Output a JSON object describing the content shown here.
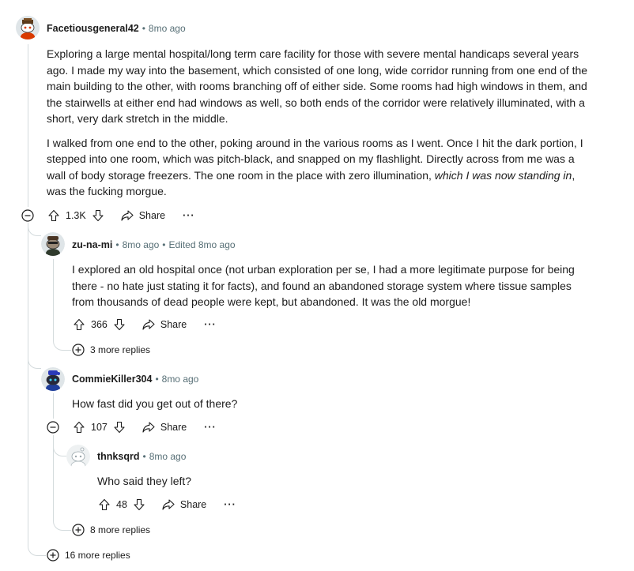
{
  "comments": {
    "c1": {
      "author": "Facetiousgeneral42",
      "time": "8mo ago",
      "para1": "Exploring a large mental hospital/long term care facility for those with severe mental handicaps several years ago. I made my way into the basement, which consisted of one long, wide corridor running from one end of the main building to the other, with rooms branching off of either side. Some rooms had high windows in them, and the stairwells at either end had windows as well, so both ends of the corridor were relatively illuminated, with a short, very dark stretch in the middle.",
      "para2_a": "I walked from one end to the other, poking around in the various rooms as I went. Once I hit the dark portion, I stepped into one room, which was pitch-black, and snapped on my flashlight. Directly across from me was a wall of body storage freezers. The one room in the place with zero illumination, ",
      "para2_em": "which I was now standing in",
      "para2_b": ", was the fucking morgue.",
      "votes": "1.3K",
      "share": "Share",
      "more_replies": "16 more replies"
    },
    "c2": {
      "author": "zu-na-mi",
      "time": "8mo ago",
      "edited": "Edited 8mo ago",
      "text": "I explored an old hospital once (not urban exploration per se, I had a more legitimate purpose for being there - no hate just stating it for facts), and found an abandoned storage system where tissue samples from thousands of dead people were kept, but abandoned. It was the old morgue!",
      "votes": "366",
      "share": "Share",
      "more_replies": "3 more replies"
    },
    "c3": {
      "author": "CommieKiller304",
      "time": "8mo ago",
      "text": "How fast did you get out of there?",
      "votes": "107",
      "share": "Share",
      "more_replies": "8 more replies"
    },
    "c4": {
      "author": "thnksqrd",
      "time": "8mo ago",
      "text": "Who said they left?",
      "votes": "48",
      "share": "Share"
    }
  },
  "colors": {
    "text": "#1c1c1c",
    "meta": "#576f76",
    "thread": "#d4dbdd"
  }
}
